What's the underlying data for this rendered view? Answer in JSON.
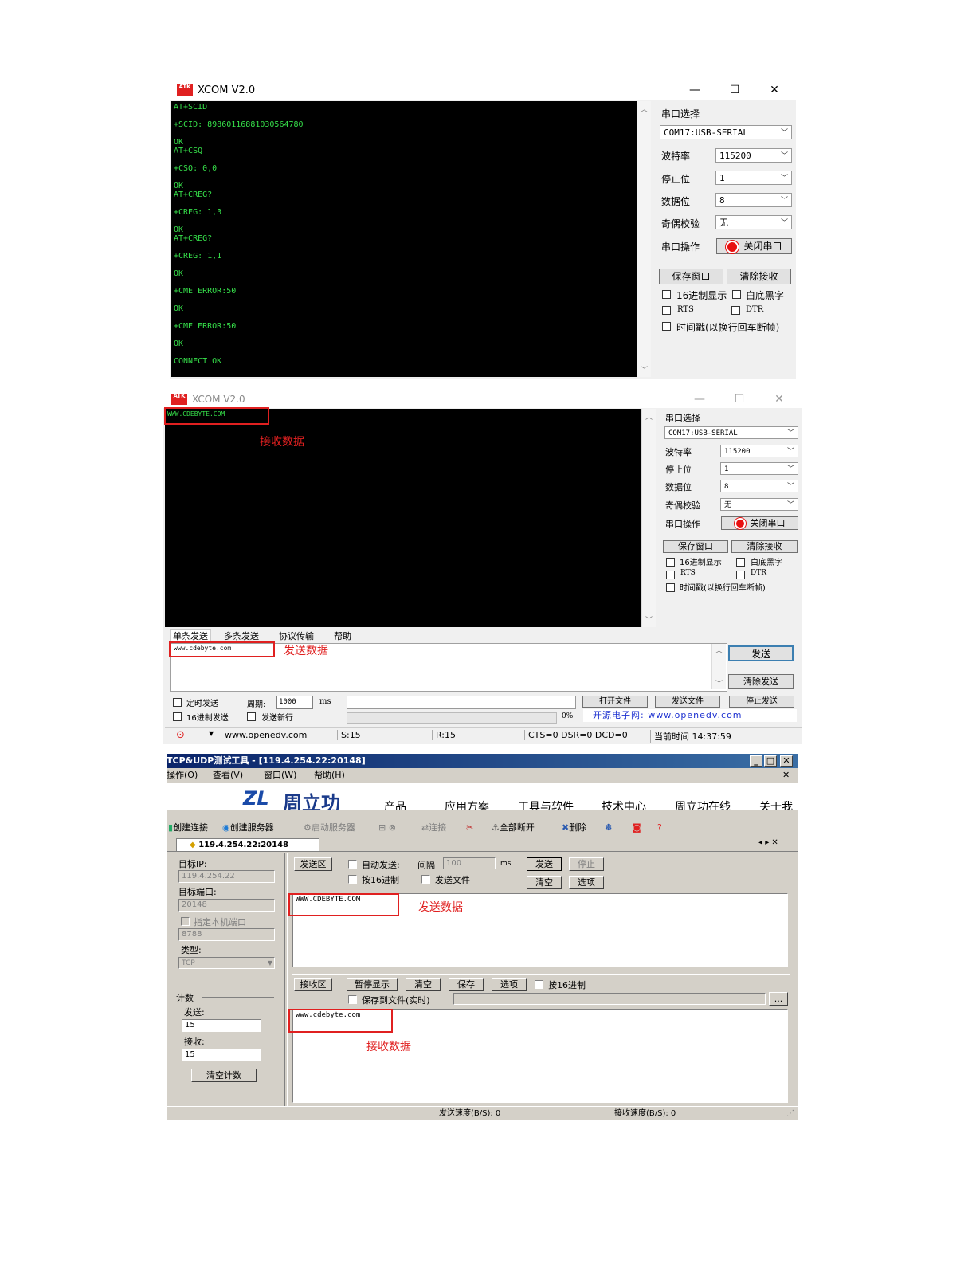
{
  "xcom1": {
    "title": "XCOM V2.0",
    "logo_text": "ATK",
    "window_controls": {
      "minimize": "—",
      "maximize": "☐",
      "close": "✕"
    },
    "terminal_lines": [
      "AT+SCID",
      "+SCID: 89860116881030564780",
      "OK",
      "AT+CSQ",
      "+CSQ: 0,0",
      "OK",
      "AT+CREG?",
      "+CREG: 1,3",
      "OK",
      "AT+CREG?",
      "+CREG: 1,1",
      "OK",
      "+CME ERROR:50",
      "OK",
      "+CME ERROR:50",
      "OK",
      "CONNECT OK"
    ],
    "panel": {
      "port_label": "串口选择",
      "port_value": "COM17:USB-SERIAL",
      "baud_label": "波特率",
      "baud_value": "115200",
      "stop_label": "停止位",
      "stop_value": "1",
      "data_label": "数据位",
      "data_value": "8",
      "parity_label": "奇偶校验",
      "parity_value": "无",
      "op_label": "串口操作",
      "close_port": "关闭串口",
      "save_window": "保存窗口",
      "clear_recv": "清除接收",
      "hex_display": "16进制显示",
      "white_bg": "白底黑字",
      "rts": "RTS",
      "dtr": "DTR",
      "timestamp": "时间戳(以换行回车断帧)"
    }
  },
  "xcom2": {
    "title": "XCOM V2.0",
    "logo_text": "ATK",
    "window_controls": {
      "minimize": "—",
      "maximize": "☐",
      "close": "✕"
    },
    "recv_text": "WWW.CDEBYTE.COM",
    "recv_annotation": "接收数据",
    "panel": {
      "port_label": "串口选择",
      "port_value": "COM17:USB-SERIAL",
      "baud_label": "波特率",
      "baud_value": "115200",
      "stop_label": "停止位",
      "stop_value": "1",
      "data_label": "数据位",
      "data_value": "8",
      "parity_label": "奇偶校验",
      "parity_value": "无",
      "op_label": "串口操作",
      "close_port": "关闭串口",
      "save_window": "保存窗口",
      "clear_recv": "清除接收",
      "hex_display": "16进制显示",
      "white_bg": "白底黑字",
      "rts": "RTS",
      "dtr": "DTR",
      "timestamp": "时间戳(以换行回车断帧)"
    },
    "tabs": [
      "单条发送",
      "多条发送",
      "协议传输",
      "帮助"
    ],
    "send_text": "www.cdebyte.com",
    "send_annotation": "发送数据",
    "send_button": "发送",
    "clear_send": "清除发送",
    "timed_send": "定时发送",
    "period_label": "周期:",
    "period_value": "1000",
    "period_unit": "ms",
    "hex_send": "16进制发送",
    "send_newline": "发送新行",
    "progress_percent": "0%",
    "open_file": "打开文件",
    "send_file": "发送文件",
    "stop_send": "停止发送",
    "site_banner": "开源电子网: www.openedv.com",
    "status": {
      "url": "www.openedv.com",
      "sent": "S:15",
      "recv": "R:15",
      "lines": "CTS=0 DSR=0 DCD=0",
      "time": "当前时间 14:37:59"
    }
  },
  "tcp": {
    "title": "TCP&UDP测试工具 - [119.4.254.22:20148]",
    "menu": [
      "操作(O)",
      "查看(V)",
      "窗口(W)",
      "帮助(H)"
    ],
    "banner": {
      "brand": "周立功",
      "nav": [
        "产品",
        "应用方案",
        "工具与软件",
        "技术中心",
        "周立功在线",
        "关于我"
      ]
    },
    "toolbar": [
      "创建连接",
      "创建服务器",
      "启动服务器",
      "连接",
      "全部断开",
      "删除"
    ],
    "tab_label": "119.4.254.22:20148",
    "left": {
      "target_ip_label": "目标IP:",
      "target_ip": "119.4.254.22",
      "target_port_label": "目标端口:",
      "target_port": "20148",
      "local_port_label": "指定本机端口",
      "local_port": "8788",
      "type_label": "类型:",
      "type_value": "TCP",
      "count_label": "计数",
      "send_label": "发送:",
      "send_count": "15",
      "recv_label": "接收:",
      "recv_count": "15",
      "clear_count": "清空计数"
    },
    "send_area": {
      "label": "发送区",
      "auto_send": "自动发送:",
      "interval_label": "间隔",
      "interval_value": "100",
      "interval_unit": "ms",
      "send": "发送",
      "stop": "停止",
      "hex": "按16进制",
      "send_file": "发送文件",
      "clear": "清空",
      "options": "选项",
      "text": "WWW.CDEBYTE.COM",
      "annotation": "发送数据"
    },
    "recv_area": {
      "label": "接收区",
      "pause": "暂停显示",
      "clear": "清空",
      "save": "保存",
      "options": "选项",
      "hex": "按16进制",
      "save_to_file": "保存到文件(实时)",
      "browse": "...",
      "text": "www.cdebyte.com",
      "annotation": "接收数据"
    },
    "status": {
      "send_rate": "发送速度(B/S): 0",
      "recv_rate": "接收速度(B/S): 0"
    }
  },
  "colors": {
    "terminal_green": "#36e04a",
    "annotation_red": "#e02020",
    "classic_gray": "#d4d0c8",
    "title_blue": "#0a246a"
  }
}
